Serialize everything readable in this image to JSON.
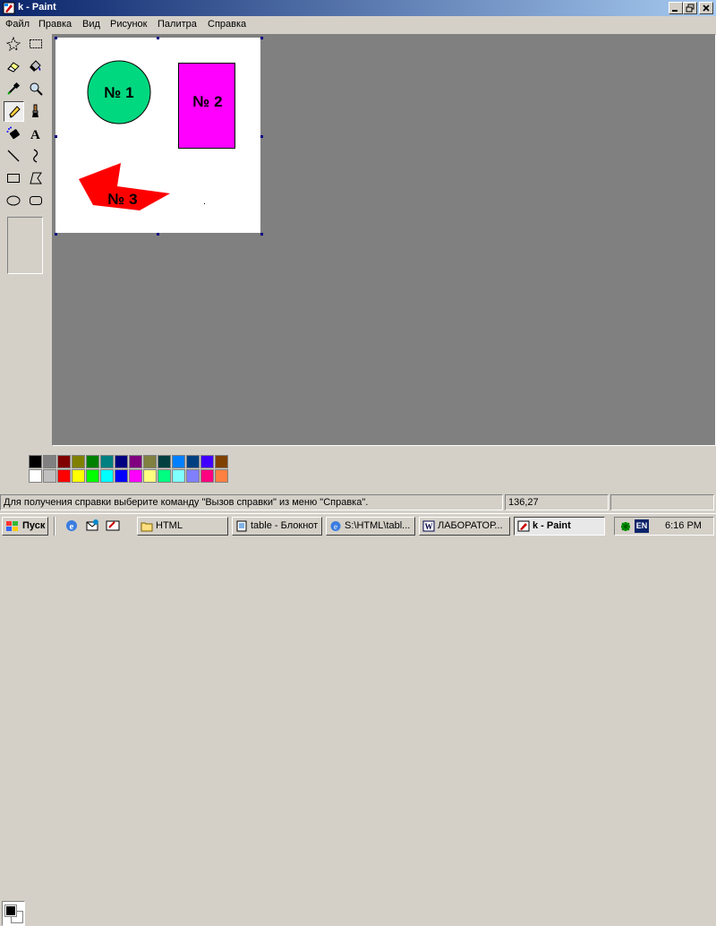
{
  "window": {
    "title": "k - Paint"
  },
  "menu": [
    "Файл",
    "Правка",
    "Вид",
    "Рисунок",
    "Палитра",
    "Справка"
  ],
  "tools": [
    {
      "name": "free-select-icon"
    },
    {
      "name": "rect-select-icon"
    },
    {
      "name": "eraser-icon"
    },
    {
      "name": "fill-bucket-icon"
    },
    {
      "name": "color-picker-icon"
    },
    {
      "name": "magnifier-icon"
    },
    {
      "name": "pencil-icon",
      "active": true
    },
    {
      "name": "brush-icon"
    },
    {
      "name": "airbrush-icon"
    },
    {
      "name": "text-icon"
    },
    {
      "name": "line-icon"
    },
    {
      "name": "curve-icon"
    },
    {
      "name": "rectangle-icon"
    },
    {
      "name": "polygon-icon"
    },
    {
      "name": "ellipse-icon"
    },
    {
      "name": "rounded-rect-icon"
    }
  ],
  "canvas": {
    "shapes": [
      {
        "kind": "circle",
        "label": "№ 1",
        "fill": "#00d880"
      },
      {
        "kind": "rect",
        "label": "№ 2",
        "fill": "#ff00ff"
      },
      {
        "kind": "polygon",
        "label": "№ 3",
        "fill": "#ff0000"
      }
    ]
  },
  "palette": {
    "foreground": "#000000",
    "background": "#ffffff",
    "top": [
      "#000000",
      "#808080",
      "#800000",
      "#808000",
      "#008000",
      "#008080",
      "#000080",
      "#800080",
      "#808040",
      "#004040",
      "#0080ff",
      "#004080",
      "#4000ff",
      "#804000"
    ],
    "bottom": [
      "#ffffff",
      "#c0c0c0",
      "#ff0000",
      "#ffff00",
      "#00ff00",
      "#00ffff",
      "#0000ff",
      "#ff00ff",
      "#ffff80",
      "#00ff80",
      "#80ffff",
      "#8080ff",
      "#ff0080",
      "#ff8040"
    ]
  },
  "status": {
    "help": "Для получения справки выберите команду \"Вызов справки\" из меню \"Справка\".",
    "coords": "136,27"
  },
  "taskbar": {
    "start": "Пуск",
    "tasks": [
      {
        "label": "HTML",
        "icon": "folder-icon"
      },
      {
        "label": "table - Блокнот",
        "icon": "notepad-icon"
      },
      {
        "label": "S:\\HTML\\tabl...",
        "icon": "browser-icon"
      },
      {
        "label": "ЛАБОРАТОР...",
        "icon": "word-icon"
      },
      {
        "label": "k - Paint",
        "icon": "paint-icon",
        "active": true
      }
    ],
    "lang": "EN",
    "clock": "6:16 PM"
  }
}
